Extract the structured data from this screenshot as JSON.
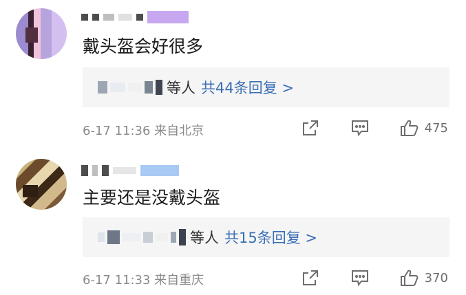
{
  "comments": [
    {
      "text": "戴头盔会好很多",
      "reply_names_suffix": "等人",
      "reply_count_text": "共44条回复 >",
      "meta": "6-17 11:36 来自北京",
      "likes": "475"
    },
    {
      "text": "主要还是没戴头盔",
      "reply_names_suffix": "等人",
      "reply_count_text": "共15条回复 >",
      "meta": "6-17 11:33 来自重庆",
      "likes": "370"
    }
  ],
  "colors": {
    "link": "#3a6eb5",
    "meta": "#8a8a8a",
    "reply_bg": "#f5f5f5"
  },
  "icons": {
    "share": "share-icon",
    "comment": "comment-icon",
    "like": "thumbs-up-icon"
  }
}
